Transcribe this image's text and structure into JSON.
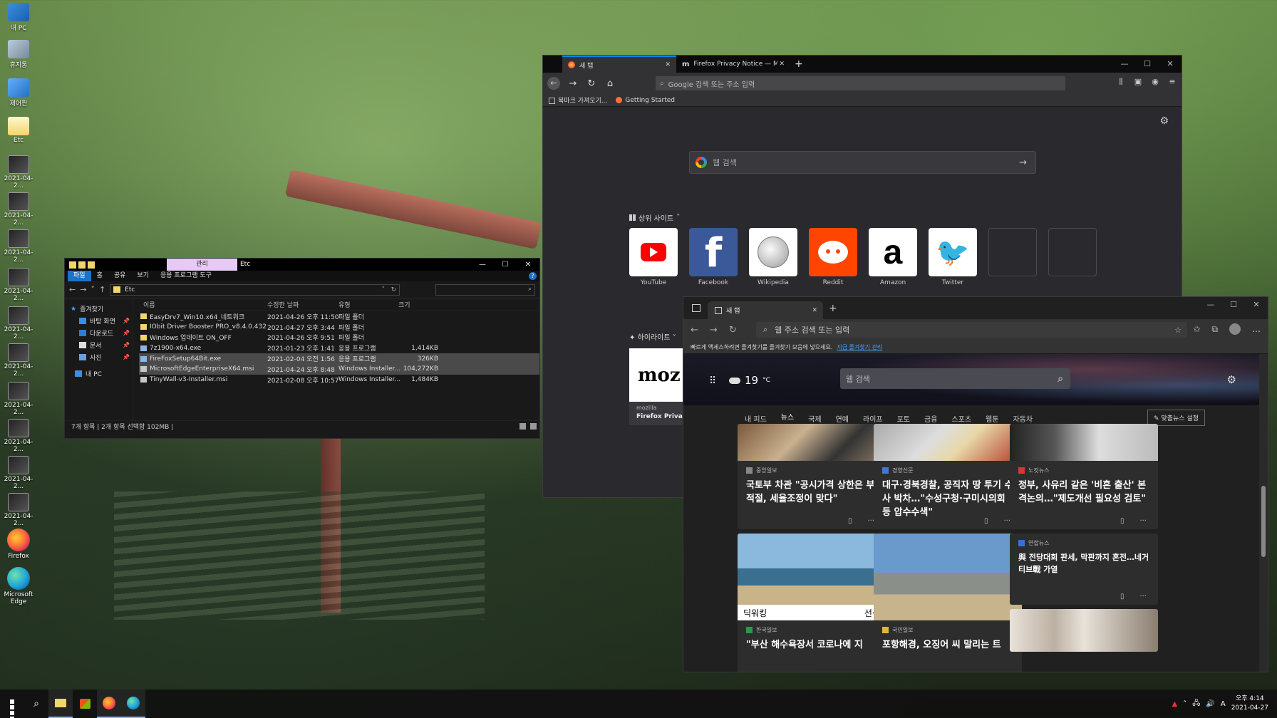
{
  "desktop": {
    "icons": [
      {
        "label": "내 PC",
        "kind": "pc"
      },
      {
        "label": "휴지통",
        "kind": "bin"
      },
      {
        "label": "제어판",
        "kind": "ctl"
      },
      {
        "label": "Etc",
        "kind": "folder"
      },
      {
        "label": "2021-04-2...",
        "kind": "thumb"
      },
      {
        "label": "2021-04-2...",
        "kind": "thumb"
      },
      {
        "label": "2021-04-2...",
        "kind": "thumb"
      },
      {
        "label": "2021-04-2...",
        "kind": "thumb"
      },
      {
        "label": "2021-04-2...",
        "kind": "thumb"
      },
      {
        "label": "2021-04-2...",
        "kind": "thumb"
      },
      {
        "label": "2021-04-2...",
        "kind": "thumb"
      },
      {
        "label": "2021-04-2...",
        "kind": "thumb"
      },
      {
        "label": "2021-04-2...",
        "kind": "thumb"
      },
      {
        "label": "2021-04-2...",
        "kind": "thumb"
      },
      {
        "label": "Firefox",
        "kind": "ff"
      },
      {
        "label": "Microsoft Edge",
        "kind": "edge"
      }
    ]
  },
  "explorer": {
    "context_tab": "관리",
    "folder_name": "Etc",
    "ribbon": [
      "파일",
      "홈",
      "공유",
      "보기",
      "응용 프로그램 도구"
    ],
    "path": "Etc",
    "nav": {
      "quick_access": "즐겨찾기",
      "items": [
        "바탕 화면",
        "다운로드",
        "문서",
        "사진"
      ],
      "pc": "내 PC"
    },
    "columns": [
      "이름",
      "수정한 날짜",
      "유형",
      "크기"
    ],
    "rows": [
      {
        "name": "EasyDrv7_Win10.x64_네트워크",
        "date": "2021-04-26 오후 11:50",
        "type": "파일 폴더",
        "size": "",
        "icon": "folder",
        "sel": false
      },
      {
        "name": "IObit Driver Booster PRO_v8.4.0.432",
        "date": "2021-04-27 오후 3:44",
        "type": "파일 폴더",
        "size": "",
        "icon": "folder",
        "sel": false
      },
      {
        "name": "Windows 업데이트 ON_OFF",
        "date": "2021-04-26 오후 9:51",
        "type": "파일 폴더",
        "size": "",
        "icon": "folder",
        "sel": false
      },
      {
        "name": "7z1900-x64.exe",
        "date": "2021-01-23 오후 1:41",
        "type": "응용 프로그램",
        "size": "1,414KB",
        "icon": "app",
        "sel": false
      },
      {
        "name": "FireFoxSetup64Bit.exe",
        "date": "2021-02-04 오전 1:56",
        "type": "응용 프로그램",
        "size": "326KB",
        "icon": "app",
        "sel": true
      },
      {
        "name": "MicrosoftEdgeEnterpriseX64.msi",
        "date": "2021-04-24 오후 8:48",
        "type": "Windows Installer...",
        "size": "104,272KB",
        "icon": "msi",
        "sel": true
      },
      {
        "name": "TinyWall-v3-Installer.msi",
        "date": "2021-02-08 오후 10:57",
        "type": "Windows Installer...",
        "size": "1,484KB",
        "icon": "msi",
        "sel": false
      }
    ],
    "status": "7개 항목  |  2개 항목 선택함 102MB  |"
  },
  "firefox": {
    "tabs": [
      {
        "title": "새 탭"
      },
      {
        "title": "Firefox Privacy Notice — Mo..."
      }
    ],
    "url_placeholder": "Google 검색 또는 주소 입력",
    "bookmarks": [
      "북마크 가져오기...",
      "Getting Started"
    ],
    "search_placeholder": "웹 검색",
    "top_sites_label": "상위 사이트",
    "top_sites": [
      {
        "label": "YouTube",
        "kind": "yt"
      },
      {
        "label": "Facebook",
        "kind": "fb",
        "glyph": "f"
      },
      {
        "label": "Wikipedia",
        "kind": "wk"
      },
      {
        "label": "Reddit",
        "kind": "rd"
      },
      {
        "label": "Amazon",
        "kind": "am",
        "glyph": "a"
      },
      {
        "label": "Twitter",
        "kind": "tw",
        "glyph": "🐦"
      },
      {
        "label": "",
        "kind": "empty"
      },
      {
        "label": "",
        "kind": "empty"
      }
    ],
    "highlights_label": "하이라이트",
    "highlight_card": {
      "image_text": "moz",
      "source": "mozilla",
      "title": "Firefox Privacy"
    }
  },
  "edge": {
    "tab_title": "새 탭",
    "url_placeholder": "웹 주소 검색 또는 입력",
    "fav_hint": "빠르게 액세스하려면 즐겨찾기를 즐겨찾기 모음에 넣으세요.",
    "fav_link": "지금 즐겨찾기 관리",
    "weather": {
      "temp": "19",
      "unit": "°C"
    },
    "search_placeholder": "웹 검색",
    "feed_tabs": [
      "내 피드",
      "뉴스",
      "국제",
      "연예",
      "라이프",
      "포토",
      "금융",
      "스포츠",
      "웹툰",
      "자동차"
    ],
    "active_feed": "뉴스",
    "customize": "맞춤뉴스 설정",
    "cards": [
      {
        "source": "중앙일보",
        "title": "국토부 차관 \"공시가격 상한은 부적절, 세율조정이 맞다\""
      },
      {
        "source": "경향신문",
        "title": "대구·경북경찰, 공직자 땅 투기 수사 박차…\"수성구청·구미시의회 등 압수수색\""
      },
      {
        "source": "노컷뉴스",
        "title": "정부, 사유리 같은 '비혼 출산' 본격논의…\"제도개선 필요성 검토\""
      },
      {
        "source": "한국일보",
        "title": "\"부산 해수욕장서 코로나에 지",
        "caption_left": "딕워킹",
        "caption_right": "선셋"
      },
      {
        "source": "국민일보",
        "title": "포항해경, 오징어 씨 말리는 트"
      },
      {
        "source": "연합뉴스",
        "title": "與 전당대회 판세, 막판까지 혼전…네거티브戰 가열"
      }
    ]
  },
  "taskbar": {
    "clock_time": "오후 4:14",
    "clock_date": "2021-04-27",
    "ime": "A"
  }
}
